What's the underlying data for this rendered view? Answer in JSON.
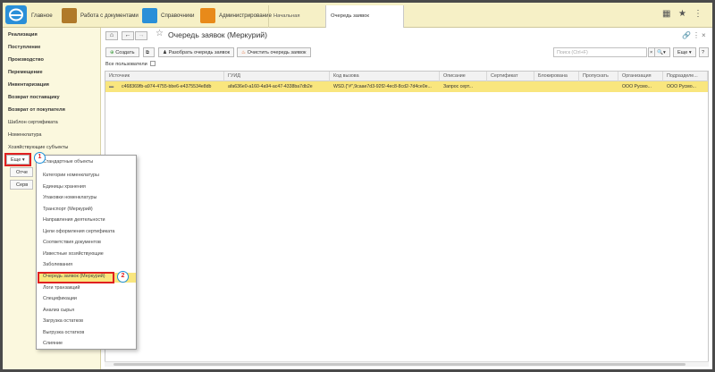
{
  "topbar": {
    "sections": [
      {
        "label": "Главное"
      },
      {
        "label": "Работа с документами"
      },
      {
        "label": "Справочники"
      },
      {
        "label": "Администрирование"
      }
    ],
    "tabs": [
      {
        "label": "Начальная страница"
      },
      {
        "label": "Очередь заявок (Меркурий)",
        "close": "×"
      }
    ]
  },
  "sidebar": {
    "items": [
      {
        "label": "Реализация"
      },
      {
        "label": "Поступление"
      },
      {
        "label": "Производство"
      },
      {
        "label": "Перемещение"
      },
      {
        "label": "Инвентаризация"
      },
      {
        "label": "Возврат поставщику"
      },
      {
        "label": "Возврат от покупателя"
      },
      {
        "label": "Шаблон сертификата"
      },
      {
        "label": "Номенклатура"
      },
      {
        "label": "Хозяйствующие субъекты"
      }
    ],
    "more_label": "Еще ▾",
    "btn1_label": "Отче",
    "btn2_label": "Серв"
  },
  "main": {
    "title": "Очередь заявок (Меркурий)",
    "toolbar": {
      "create_label": "Создать",
      "parse_label": "Разобрать очередь заявок",
      "clear_label": "Очистить очередь заявок",
      "search_placeholder": "Поиск (Ctrl+F)",
      "more_label": "Еще ▾",
      "help_label": "?"
    },
    "all_users_label": "Все пользователи",
    "columns": [
      "Источник",
      "ГУИД",
      "Код вызова",
      "Описание",
      "Сертификат",
      "Блокирована",
      "Пропускать",
      "Организация",
      "Подразделе..."
    ],
    "rows": [
      [
        "c468369fb-a974-4755-bbe6-e4375534e8db",
        "afa636e0-a160-4a94-ac47-4338ba7db2e",
        "WSD.{\"#\",9caae7d3-92f2-4ec8-8cd2-7d4ce0e...",
        "Запрос серт...",
        "",
        "",
        "",
        "ООО Русмо...",
        "ООО Русмо..."
      ]
    ]
  },
  "menu": {
    "items": [
      {
        "label": "Стандартные объекты"
      },
      {
        "label": "Категории номенклатуры"
      },
      {
        "label": "Единицы хранения"
      },
      {
        "label": "Упаковки номенклатуры"
      },
      {
        "label": "Транспорт (Меркурий)"
      },
      {
        "label": "Направления деятельности"
      },
      {
        "label": "Цели оформления сертификата"
      },
      {
        "label": "Соответствия документов"
      },
      {
        "label": "Известные хозяйствующие"
      },
      {
        "label": "Заболевания"
      },
      {
        "label": "Очередь заявок (Меркурий)"
      },
      {
        "label": "Логи транзакций"
      },
      {
        "label": "Спецификации"
      },
      {
        "label": "Анализ сырья"
      },
      {
        "label": "Загрузка остатков"
      },
      {
        "label": "Выгрузка остатков"
      },
      {
        "label": "Слияние"
      }
    ]
  },
  "badges": {
    "one": "1",
    "two": "2"
  },
  "colors": {
    "topbar": "#f6f0c6",
    "highlight": "#f9e67e",
    "callout": "#e02020",
    "badge_ring": "#1c8fd8"
  }
}
